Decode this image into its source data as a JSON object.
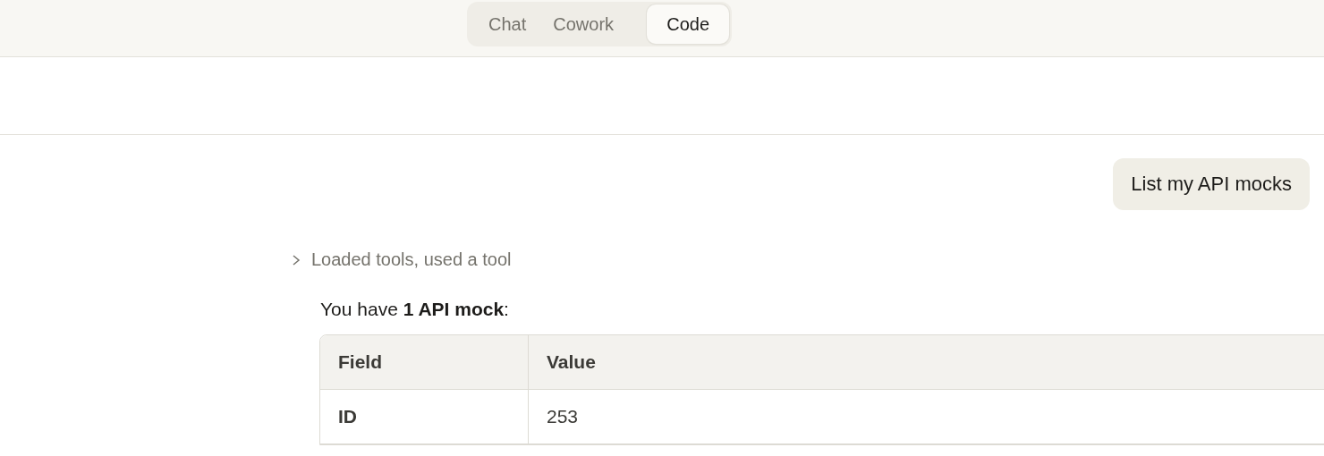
{
  "mode_tabs": [
    {
      "label": "Chat",
      "selected": false
    },
    {
      "label": "Cowork",
      "selected": false
    },
    {
      "label": "Code",
      "selected": true
    }
  ],
  "conversation": {
    "user_message": "List my API mocks",
    "tool_summary": {
      "label": "Loaded tools, used a tool",
      "expanded": false
    },
    "reply_text": "You have **1 API mock**:",
    "table": {
      "columns": [
        "Field",
        "Value"
      ],
      "rows": [
        [
          "ID",
          "253"
        ]
      ]
    }
  }
}
